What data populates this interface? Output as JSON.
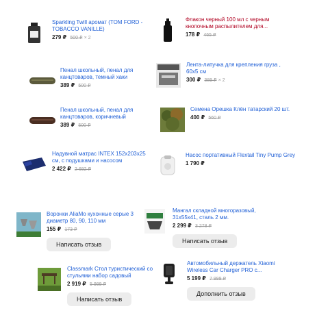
{
  "currency": "₽",
  "items": [
    {
      "title": "Sparkling Twill аромат (TOM FORD - TOBACCO VANILLE)",
      "price": "279 ₽",
      "old_price": "500 ₽",
      "qty": "× 2"
    },
    {
      "title": "Флакон черный 100 мл с черным кнопочным распылителем для...",
      "price": "178 ₽",
      "old_price": "465 ₽"
    },
    {
      "title": "Пенал школьный, пенал для канцтоваров, темный хаки",
      "price": "389 ₽",
      "old_price": "500 ₽"
    },
    {
      "title": "Лента-липучка для крепления груза , 60х5 см",
      "price": "300 ₽",
      "old_price": "389 ₽",
      "qty": "× 2"
    },
    {
      "title": "Пенал школьный, пенал для канцтоваров, коричневый",
      "price": "389 ₽",
      "old_price": "500 ₽"
    },
    {
      "title": "Семена Орешка Клён татарский 20 шт.",
      "price": "400 ₽",
      "old_price": "560 ₽"
    },
    {
      "title": "Надувной матрас INTEX 152x203x25 см, с подушками и насосом",
      "price": "2 422 ₽",
      "old_price": "2 692 ₽"
    },
    {
      "title": "Насос портативный Flextail Tiny Pump Grey",
      "price": "1 790 ₽"
    },
    {
      "title": "Воронки AliaMo кухонные серые 3 диаметр 80, 90, 110 мм",
      "price": "155 ₽",
      "old_price": "173 ₽",
      "button": "Написать отзыв"
    },
    {
      "title": "Мангал складной многоразовый, 31х55х41, сталь 2 мм.",
      "price": "2 299 ₽",
      "old_price": "3 278 ₽",
      "button": "Написать отзыв"
    },
    {
      "title": "Classmark Стол туристический со стульями набор садовый",
      "price": "2 919 ₽",
      "old_price": "5 999 ₽",
      "button": "Написать отзыв"
    },
    {
      "title": "Автомобильный держатель Xiaomi Wireless Car Charger PRO с...",
      "price": "5 199 ₽",
      "old_price": "7 999 ₽",
      "button": "Дополнить отзыв"
    }
  ]
}
